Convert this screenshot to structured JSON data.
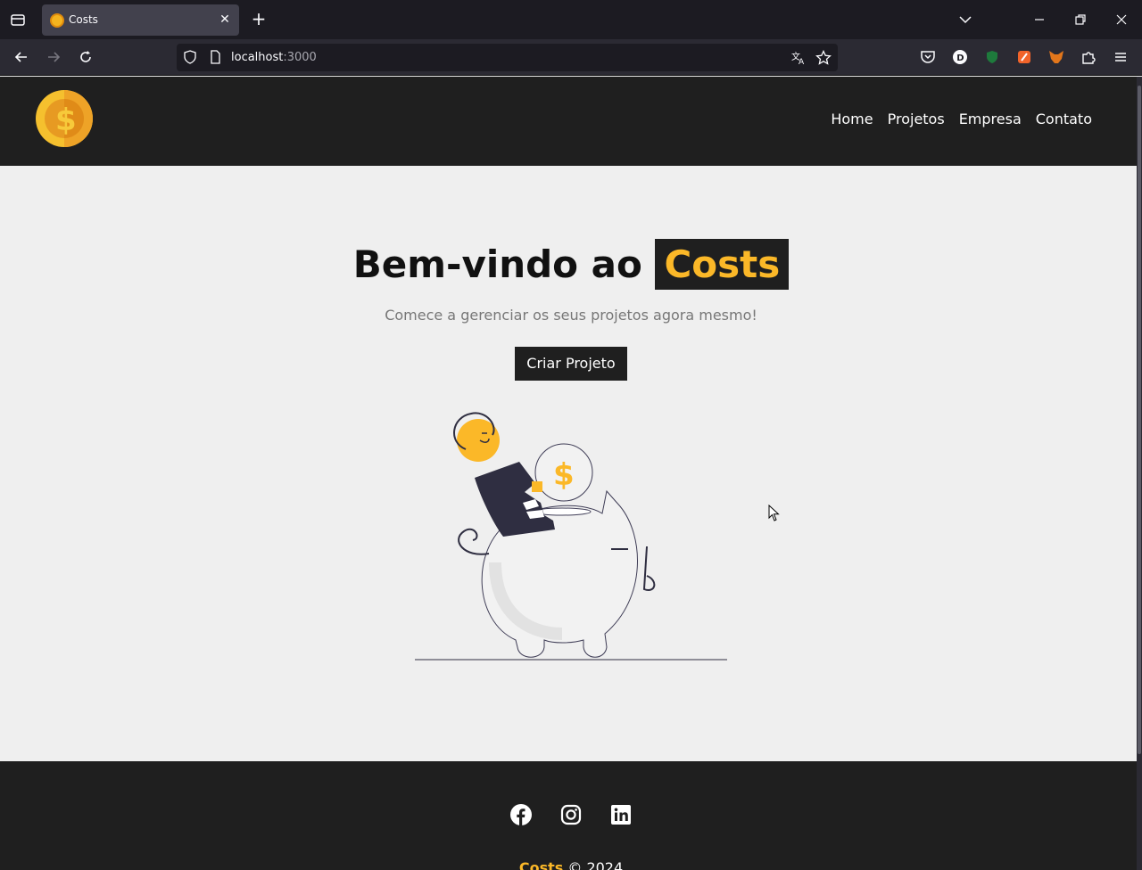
{
  "browser": {
    "tab_title": "Costs",
    "url_host": "localhost",
    "url_port": ":3000"
  },
  "header": {
    "nav": [
      "Home",
      "Projetos",
      "Empresa",
      "Contato"
    ]
  },
  "hero": {
    "title_prefix": "Bem-vindo ao",
    "title_brand": "Costs",
    "subtitle": "Comece a gerenciar os seus projetos agora mesmo!",
    "cta_label": "Criar Projeto"
  },
  "footer": {
    "brand": "Costs",
    "copyright": "© 2024",
    "social_icons": [
      "facebook-icon",
      "instagram-icon",
      "linkedin-icon"
    ]
  },
  "colors": {
    "brand_yellow": "#fbb828",
    "dark": "#1f1f1f",
    "background": "#efefef"
  }
}
